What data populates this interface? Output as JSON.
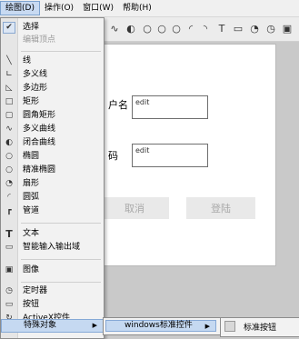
{
  "menubar": {
    "items": [
      "绘图(D)",
      "操作(O)",
      "窗口(W)",
      "帮助(H)"
    ]
  },
  "toolbar": {
    "icons": [
      "line-icon",
      "curve-icon",
      "spiral-icon",
      "circle-icon",
      "ellipse-icon",
      "circle-icon",
      "arc-icon",
      "text-icon",
      "stopwatch-icon",
      "clock-icon",
      "image-icon",
      "timer-icon"
    ]
  },
  "form": {
    "label1": "户名",
    "label2": "码",
    "edit1": "edit",
    "edit2": "edit",
    "cancel": "取消",
    "login": "登陆"
  },
  "menu": {
    "select": "选择",
    "edit_vertex": "编辑顶点",
    "line": "线",
    "polyline": "多义线",
    "polygon": "多边形",
    "rect": "矩形",
    "round_rect": "圆角矩形",
    "poly_curve": "多义曲线",
    "closed_curve": "闭合曲线",
    "ellipse": "椭圆",
    "precise_ellipse": "精准椭圆",
    "sector": "扇形",
    "arc": "圆弧",
    "pipe": "管道",
    "text": "文本",
    "smart_io": "智能输入输出域",
    "image": "图像",
    "timer": "定时器",
    "button": "按钮",
    "activex": "ActiveX控件",
    "special": "特殊对象"
  },
  "submenu": {
    "windows_controls": "windows标准控件",
    "standard_button": "标准按钮"
  }
}
